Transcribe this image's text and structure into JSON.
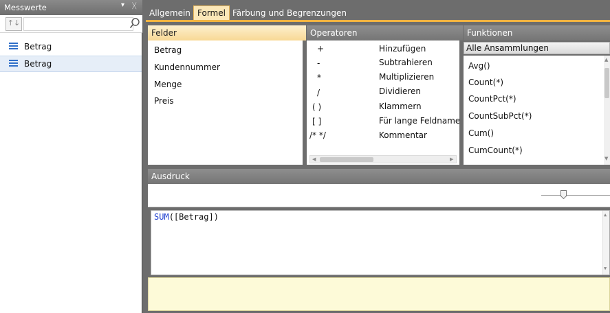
{
  "left_panel": {
    "title": "Messwerte",
    "menu_glyph": "▾",
    "pin_glyph": "ᚷ",
    "sort_glyph": "↑↓",
    "search_value": "",
    "search_placeholder": "",
    "items": [
      {
        "label": "Betrag",
        "icon": "list-icon",
        "selected": false
      },
      {
        "label": "Betrag",
        "icon": "list-icon",
        "selected": true
      }
    ]
  },
  "tabs": [
    {
      "label": "Allgemein",
      "active": false
    },
    {
      "label": "Formel",
      "active": true
    },
    {
      "label": "Färbung und Begrenzungen",
      "active": false
    }
  ],
  "felder": {
    "title": "Felder",
    "items": [
      "Betrag",
      "Kundennummer",
      "Menge",
      "Preis"
    ]
  },
  "operatoren": {
    "title": "Operatoren",
    "items": [
      {
        "symbol": "+",
        "name": "Hinzufügen"
      },
      {
        "symbol": "-",
        "name": "Subtrahieren"
      },
      {
        "symbol": "*",
        "name": "Multiplizieren"
      },
      {
        "symbol": "/",
        "name": "Dividieren"
      },
      {
        "symbol": "( )",
        "name": "Klammern"
      },
      {
        "symbol": "[ ]",
        "name": "Für lange Feldnamen"
      },
      {
        "symbol": "/* */",
        "name": "Kommentar"
      }
    ]
  },
  "funktionen": {
    "title": "Funktionen",
    "category": "Alle Ansammlungen",
    "items": [
      "Avg()",
      "Count(*)",
      "CountPct(*)",
      "CountSubPct(*)",
      "Cum()",
      "CumCount(*)"
    ]
  },
  "ausdruck": {
    "title": "Ausdruck",
    "expression_function": "SUM",
    "expression_rest": "([Betrag])",
    "message": ""
  },
  "colors": {
    "accent": "#f2b441",
    "active_tab_bg": "#fbe7b8",
    "header_gray": "#7f7f7f",
    "message_bg": "#fdfad8",
    "function_blue": "#1f3fd0",
    "list_icon_blue": "#2f6fc9"
  }
}
